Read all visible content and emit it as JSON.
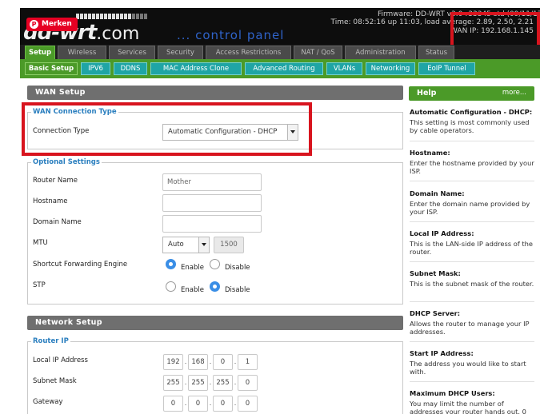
{
  "header": {
    "logo_text": "dd-wrt",
    "logo_suffix": ".com",
    "tagline": "... control panel",
    "firmware": "Firmware: DD-WRT v3.0-r33345 std (09/11/17)",
    "time": "Time: 08:52:16 up 11:03, load average: 2.89, 2.50, 2.21",
    "wan_ip": "WAN IP: 192.168.1.145"
  },
  "pin_badge": {
    "label": "Merken",
    "icon": "P"
  },
  "main_tabs": [
    "Setup",
    "Wireless",
    "Services",
    "Security",
    "Access Restrictions",
    "NAT / QoS",
    "Administration",
    "Status"
  ],
  "sub_tabs": [
    "Basic Setup",
    "IPV6",
    "DDNS",
    "MAC Address Clone",
    "Advanced Routing",
    "VLANs",
    "Networking",
    "EoIP Tunnel"
  ],
  "wan_setup": {
    "title": "WAN Setup",
    "conn_group": "WAN Connection Type",
    "conn_label": "Connection Type",
    "conn_value": "Automatic Configuration - DHCP"
  },
  "optional": {
    "group": "Optional Settings",
    "router_name_label": "Router Name",
    "router_name_value": "Mother",
    "hostname_label": "Hostname",
    "hostname_value": "",
    "domain_label": "Domain Name",
    "domain_value": "",
    "mtu_label": "MTU",
    "mtu_mode": "Auto",
    "mtu_value": "1500",
    "sfe_label": "Shortcut Forwarding Engine",
    "stp_label": "STP",
    "enable": "Enable",
    "disable": "Disable",
    "sfe_selected": "Enable",
    "stp_selected": "Disable"
  },
  "network_setup": {
    "title": "Network Setup",
    "group": "Router IP",
    "local_ip_label": "Local IP Address",
    "local_ip": [
      "192",
      "168",
      "0",
      "1"
    ],
    "subnet_label": "Subnet Mask",
    "subnet": [
      "255",
      "255",
      "255",
      "0"
    ],
    "gateway_label": "Gateway",
    "gateway": [
      "0",
      "0",
      "0",
      "0"
    ]
  },
  "help": {
    "title": "Help",
    "more": "more...",
    "items": [
      {
        "h": "Automatic Configuration - DHCP:",
        "t": "This setting is most commonly used by cable operators."
      },
      {
        "h": "Hostname:",
        "t": "Enter the hostname provided by your ISP."
      },
      {
        "h": "Domain Name:",
        "t": "Enter the domain name provided by your ISP."
      },
      {
        "h": "Local IP Address:",
        "t": "This is the LAN-side IP address of the router."
      },
      {
        "h": "Subnet Mask:",
        "t": "This is the subnet mask of the router."
      },
      {
        "h": "DHCP Server:",
        "t": "Allows the router to manage your IP addresses."
      },
      {
        "h": "Start IP Address:",
        "t": "The address you would like to start with."
      },
      {
        "h": "Maximum DHCP Users:",
        "t": "You may limit the number of addresses your router hands out. 0"
      }
    ]
  },
  "colors": {
    "accent_green": "#4b9a28",
    "subtab_teal": "#1fa5a5",
    "legend_blue": "#2b7fbf",
    "highlight_red": "#d8141e",
    "pin_red": "#e60023"
  }
}
